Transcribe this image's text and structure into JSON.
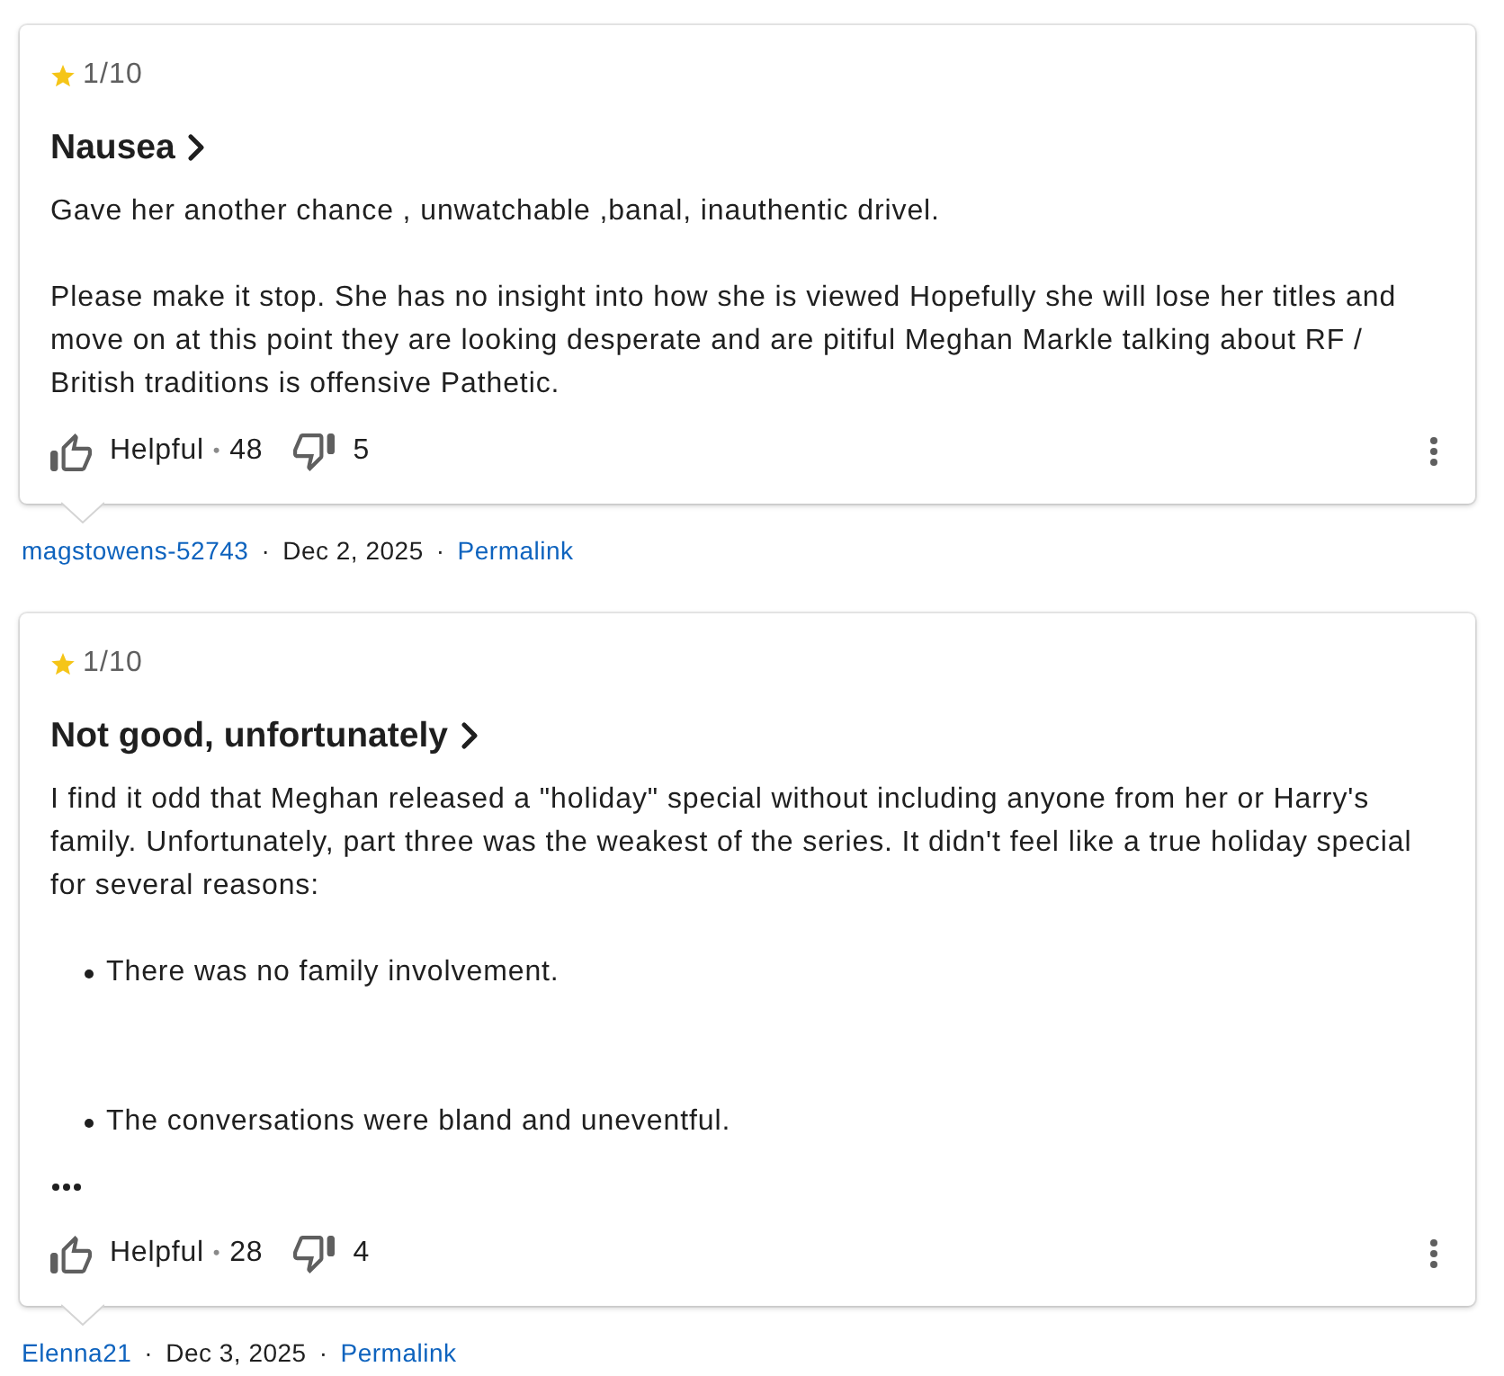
{
  "reviews": [
    {
      "rating": "1/10",
      "title": "Nausea",
      "body": [
        {
          "kind": "paragraph",
          "text": "Gave her another chance , unwatchable ,banal, inauthentic drivel."
        },
        {
          "kind": "paragraph",
          "text": "Please make it stop. She has no insight into how she is viewed Hopefully she will lose her titles and move on at this point they are looking desperate and are pitiful Meghan Markle talking about RF / British traditions is offensive Pathetic."
        }
      ],
      "truncated": false,
      "helpful": {
        "label": "Helpful",
        "separator": "•",
        "count": "48"
      },
      "unhelpful": {
        "count": "5"
      },
      "meta": [
        {
          "kind": "link",
          "text": "magstowens-52743"
        },
        {
          "kind": "separator",
          "text": "·"
        },
        {
          "kind": "date",
          "text": "Dec 2, 2025"
        },
        {
          "kind": "separator",
          "text": "·"
        },
        {
          "kind": "link",
          "text": "Permalink"
        }
      ]
    },
    {
      "rating": "1/10",
      "title": "Not good, unfortunately",
      "body": [
        {
          "kind": "paragraph",
          "text": "I find it odd that Meghan released a \"holiday\" special without including anyone from her or Harry's family. Unfortunately, part three was the weakest of the series. It didn't feel like a true holiday special for several reasons:"
        },
        {
          "kind": "list",
          "items": [
            "There was no family involvement.",
            "The conversations were bland and uneventful."
          ]
        }
      ],
      "truncated": true,
      "helpful": {
        "label": "Helpful",
        "separator": "•",
        "count": "28"
      },
      "unhelpful": {
        "count": "4"
      },
      "meta": [
        {
          "kind": "link",
          "text": "Elenna21"
        },
        {
          "kind": "separator",
          "text": "·"
        },
        {
          "kind": "date",
          "text": "Dec 3, 2025"
        },
        {
          "kind": "separator",
          "text": "·"
        },
        {
          "kind": "link",
          "text": "Permalink"
        }
      ]
    }
  ]
}
